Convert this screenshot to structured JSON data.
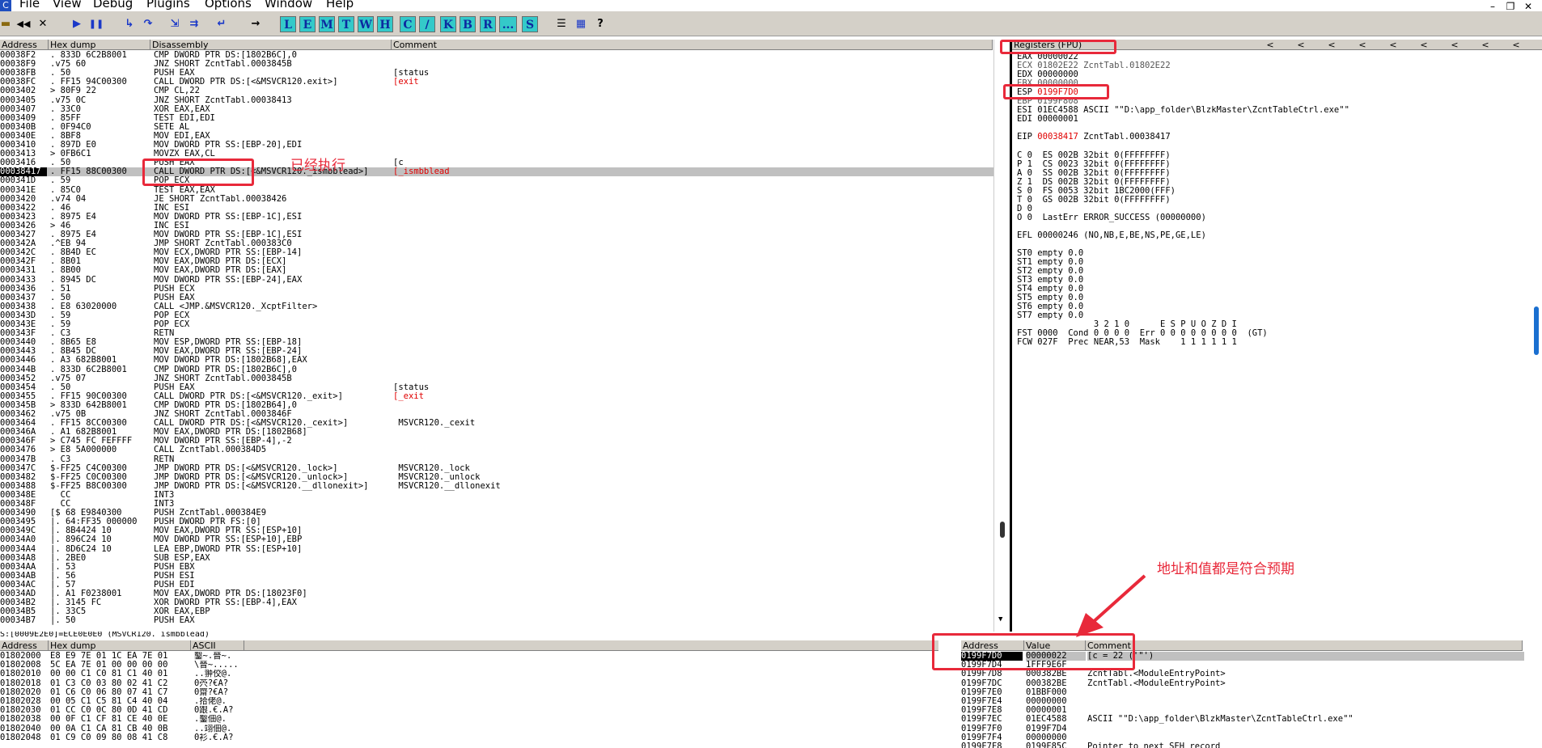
{
  "menubar": {
    "app_icon": "C",
    "items": [
      "File",
      "View",
      "Debug",
      "Plugins",
      "Options",
      "Window",
      "Help"
    ]
  },
  "toolbar": {
    "buttons": [
      {
        "name": "open-icon",
        "glyph": "▬"
      },
      {
        "name": "restart-icon",
        "glyph": "◀◀"
      },
      {
        "name": "close-icon",
        "glyph": "✕"
      },
      {
        "name": "run-icon",
        "glyph": "▶"
      },
      {
        "name": "pause-icon",
        "glyph": "❚❚"
      },
      {
        "name": "step-into-icon",
        "glyph": "↳"
      },
      {
        "name": "step-over-icon",
        "glyph": "↷"
      },
      {
        "name": "trace-into-icon",
        "glyph": "⇲"
      },
      {
        "name": "trace-over-icon",
        "glyph": "⇉"
      },
      {
        "name": "execute-till-return-icon",
        "glyph": "↵"
      },
      {
        "name": "goto-icon",
        "glyph": "→"
      }
    ],
    "letters": [
      "L",
      "E",
      "M",
      "T",
      "W",
      "H",
      "C",
      "/",
      "K",
      "B",
      "R",
      "...",
      "S"
    ],
    "extra": [
      {
        "name": "list-icon",
        "glyph": "☰"
      },
      {
        "name": "grid-icon",
        "glyph": "▦"
      },
      {
        "name": "help-icon",
        "glyph": "?"
      }
    ]
  },
  "disasm": {
    "headers": [
      "Address",
      "Hex dump",
      "Disassembly",
      "Comment"
    ],
    "rows": [
      [
        "00038F2",
        ". 833D 6C2B8001",
        "CMP DWORD PTR DS:[1802B6C],0",
        ""
      ],
      [
        "00038F9",
        ".v75 60",
        "JNZ SHORT ZcntTabl.0003845B",
        ""
      ],
      [
        "00038FB",
        ". 50",
        "PUSH EAX",
        "[status"
      ],
      [
        "00038FC",
        ". FF15 94C00300",
        "CALL DWORD PTR DS:[<&MSVCR120.exit>]",
        "[exit"
      ],
      [
        "0003402",
        "> 80F9 22",
        "CMP CL,22",
        ""
      ],
      [
        "0003405",
        ".v75 0C",
        "JNZ SHORT ZcntTabl.00038413",
        ""
      ],
      [
        "0003407",
        ". 33C0",
        "XOR EAX,EAX",
        ""
      ],
      [
        "0003409",
        ". 85FF",
        "TEST EDI,EDI",
        ""
      ],
      [
        "000340B",
        ". 0F94C0",
        "SETE AL",
        ""
      ],
      [
        "000340E",
        ". 8BF8",
        "MOV EDI,EAX",
        ""
      ],
      [
        "0003410",
        ". 897D E0",
        "MOV DWORD PTR SS:[EBP-20],EDI",
        ""
      ],
      [
        "0003413",
        "> 0FB6C1",
        "MOVZX EAX,CL",
        ""
      ],
      [
        "0003416",
        ". 50",
        "PUSH EAX",
        "[c"
      ],
      [
        "00038417",
        ". FF15 88C00300",
        "CALL DWORD PTR DS:[<&MSVCR120._ismbblead>]",
        "[_ismbblead"
      ],
      [
        "000341D",
        ". 59",
        "POP ECX",
        ""
      ],
      [
        "000341E",
        ". 85C0",
        "TEST EAX,EAX",
        ""
      ],
      [
        "0003420",
        ".v74 04",
        "JE SHORT ZcntTabl.00038426",
        ""
      ],
      [
        "0003422",
        ". 46",
        "INC ESI",
        ""
      ],
      [
        "0003423",
        ". 8975 E4",
        "MOV DWORD PTR SS:[EBP-1C],ESI",
        ""
      ],
      [
        "0003426",
        "> 46",
        "INC ESI",
        ""
      ],
      [
        "0003427",
        ". 8975 E4",
        "MOV DWORD PTR SS:[EBP-1C],ESI",
        ""
      ],
      [
        "000342A",
        ".^EB 94",
        "JMP SHORT ZcntTabl.000383C0",
        ""
      ],
      [
        "000342C",
        ". 8B4D EC",
        "MOV ECX,DWORD PTR SS:[EBP-14]",
        ""
      ],
      [
        "000342F",
        ". 8B01",
        "MOV EAX,DWORD PTR DS:[ECX]",
        ""
      ],
      [
        "0003431",
        ". 8B00",
        "MOV EAX,DWORD PTR DS:[EAX]",
        ""
      ],
      [
        "0003433",
        ". 8945 DC",
        "MOV DWORD PTR SS:[EBP-24],EAX",
        ""
      ],
      [
        "0003436",
        ". 51",
        "PUSH ECX",
        ""
      ],
      [
        "0003437",
        ". 50",
        "PUSH EAX",
        ""
      ],
      [
        "0003438",
        ". E8 63020000",
        "CALL <JMP.&MSVCR120._XcptFilter>",
        ""
      ],
      [
        "000343D",
        ". 59",
        "POP ECX",
        ""
      ],
      [
        "000343E",
        ". 59",
        "POP ECX",
        ""
      ],
      [
        "000343F",
        ". C3",
        "RETN",
        ""
      ],
      [
        "0003440",
        ". 8B65 E8",
        "MOV ESP,DWORD PTR SS:[EBP-18]",
        ""
      ],
      [
        "0003443",
        ". 8B45 DC",
        "MOV EAX,DWORD PTR SS:[EBP-24]",
        ""
      ],
      [
        "0003446",
        ". A3 682B8001",
        "MOV DWORD PTR DS:[1802B68],EAX",
        ""
      ],
      [
        "000344B",
        ". 833D 6C2B8001",
        "CMP DWORD PTR DS:[1802B6C],0",
        ""
      ],
      [
        "0003452",
        ".v75 07",
        "JNZ SHORT ZcntTabl.0003845B",
        ""
      ],
      [
        "0003454",
        ". 50",
        "PUSH EAX",
        "[status"
      ],
      [
        "0003455",
        ". FF15 90C00300",
        "CALL DWORD PTR DS:[<&MSVCR120._exit>]",
        "[_exit"
      ],
      [
        "000345B",
        "> 833D 642B8001",
        "CMP DWORD PTR DS:[1802B64],0",
        ""
      ],
      [
        "0003462",
        ".v75 0B",
        "JNZ SHORT ZcntTabl.0003846F",
        ""
      ],
      [
        "0003464",
        ". FF15 8CC00300",
        "CALL DWORD PTR DS:[<&MSVCR120._cexit>]",
        " MSVCR120._cexit"
      ],
      [
        "000346A",
        ". A1 682B8001",
        "MOV EAX,DWORD PTR DS:[1802B68]",
        ""
      ],
      [
        "000346F",
        "> C745 FC FEFFFF",
        "MOV DWORD PTR SS:[EBP-4],-2",
        ""
      ],
      [
        "0003476",
        "> E8 5A000000",
        "CALL ZcntTabl.000384D5",
        ""
      ],
      [
        "000347B",
        ". C3",
        "RETN",
        ""
      ],
      [
        "000347C",
        "$-FF25 C4C00300",
        "JMP DWORD PTR DS:[<&MSVCR120._lock>]",
        " MSVCR120._lock"
      ],
      [
        "0003482",
        "$-FF25 C0C00300",
        "JMP DWORD PTR DS:[<&MSVCR120._unlock>]",
        " MSVCR120._unlock"
      ],
      [
        "0003488",
        "$-FF25 B8C00300",
        "JMP DWORD PTR DS:[<&MSVCR120.__dllonexit>]",
        " MSVCR120.__dllonexit"
      ],
      [
        "000348E",
        "  CC",
        "INT3",
        ""
      ],
      [
        "000348F",
        "  CC",
        "INT3",
        ""
      ],
      [
        "0003490",
        "[$ 68 E9840300",
        "PUSH ZcntTabl.000384E9",
        ""
      ],
      [
        "0003495",
        "|. 64:FF35 000000",
        "PUSH DWORD PTR FS:[0]",
        ""
      ],
      [
        "000349C",
        "|. 8B4424 10",
        "MOV EAX,DWORD PTR SS:[ESP+10]",
        ""
      ],
      [
        "00034A0",
        "|. 896C24 10",
        "MOV DWORD PTR SS:[ESP+10],EBP",
        ""
      ],
      [
        "00034A4",
        "|. 8D6C24 10",
        "LEA EBP,DWORD PTR SS:[ESP+10]",
        ""
      ],
      [
        "00034A8",
        "|. 2BE0",
        "SUB ESP,EAX",
        ""
      ],
      [
        "00034AA",
        "|. 53",
        "PUSH EBX",
        ""
      ],
      [
        "00034AB",
        "|. 56",
        "PUSH ESI",
        ""
      ],
      [
        "00034AC",
        "|. 57",
        "PUSH EDI",
        ""
      ],
      [
        "00034AD",
        "|. A1 F0238001",
        "MOV EAX,DWORD PTR DS:[18023F0]",
        ""
      ],
      [
        "00034B2",
        "|. 3145 FC",
        "XOR DWORD PTR SS:[EBP-4],EAX",
        ""
      ],
      [
        "00034B5",
        "|. 33C5",
        "XOR EAX,EBP",
        ""
      ],
      [
        "00034B7",
        "|. 50",
        "PUSH EAX",
        ""
      ]
    ],
    "status_line": "S:[0009E2E0]=ECE0E0E0 (MSVCR120._ismbblead)"
  },
  "registers": {
    "title": "Registers (FPU)",
    "arrows": [
      "<",
      "<",
      "<",
      "<",
      "<",
      "<",
      "<",
      "<",
      "<"
    ],
    "lines": [
      {
        "t": "EAX 00000022",
        "c": ""
      },
      {
        "t": "ECX 01802E22 ZcntTabl.01802E22",
        "c": "gray"
      },
      {
        "t": "EDX 00000000",
        "c": ""
      },
      {
        "t": "EBX 00000000",
        "c": "gray"
      },
      {
        "t": "ESP ",
        "v": "0199F7D0",
        "c": ""
      },
      {
        "t": "EBP 0199F808",
        "c": "gray"
      },
      {
        "t": "ESI 01EC4588 ASCII \"\"D:\\app_folder\\BlzkMaster\\ZcntTableCtrl.exe\"\"",
        "c": ""
      },
      {
        "t": "EDI 00000001",
        "c": ""
      },
      {
        "t": "",
        "c": ""
      },
      {
        "t": "EIP ",
        "v": "00038417",
        "tail": " ZcntTabl.00038417",
        "c": ""
      },
      {
        "t": "",
        "c": ""
      },
      {
        "t": "C 0  ES 002B 32bit 0(FFFFFFFF)",
        "c": ""
      },
      {
        "t": "P 1  CS 0023 32bit 0(FFFFFFFF)",
        "c": ""
      },
      {
        "t": "A 0  SS 002B 32bit 0(FFFFFFFF)",
        "c": ""
      },
      {
        "t": "Z 1  DS 002B 32bit 0(FFFFFFFF)",
        "c": ""
      },
      {
        "t": "S 0  FS 0053 32bit 1BC2000(FFF)",
        "c": ""
      },
      {
        "t": "T 0  GS 002B 32bit 0(FFFFFFFF)",
        "c": ""
      },
      {
        "t": "D 0",
        "c": ""
      },
      {
        "t": "O 0  LastErr ERROR_SUCCESS (00000000)",
        "c": ""
      },
      {
        "t": "",
        "c": ""
      },
      {
        "t": "EFL 00000246 (NO,NB,E,BE,NS,PE,GE,LE)",
        "c": ""
      },
      {
        "t": "",
        "c": ""
      },
      {
        "t": "ST0 empty 0.0",
        "c": ""
      },
      {
        "t": "ST1 empty 0.0",
        "c": ""
      },
      {
        "t": "ST2 empty 0.0",
        "c": ""
      },
      {
        "t": "ST3 empty 0.0",
        "c": ""
      },
      {
        "t": "ST4 empty 0.0",
        "c": ""
      },
      {
        "t": "ST5 empty 0.0",
        "c": ""
      },
      {
        "t": "ST6 empty 0.0",
        "c": ""
      },
      {
        "t": "ST7 empty 0.0",
        "c": ""
      },
      {
        "t": "               3 2 1 0      E S P U O Z D I",
        "c": ""
      },
      {
        "t": "FST 0000  Cond 0 0 0 0  Err 0 0 0 0 0 0 0 0  (GT)",
        "c": ""
      },
      {
        "t": "FCW 027F  Prec NEAR,53  Mask    1 1 1 1 1 1",
        "c": ""
      }
    ]
  },
  "dump": {
    "headers": [
      "Address",
      "Hex dump",
      "ASCII"
    ],
    "rows": [
      [
        "01802000",
        "E8 E9 7E 01 1C EA 7E 01",
        "鑿~.晉~."
      ],
      [
        "01802008",
        "5C EA 7E 01 00 00 00 00",
        "\\晉~....."
      ],
      [
        "01802010",
        "00 00 C1 C0 81 C1 40 01",
        "..翀佼@."
      ],
      [
        "01802018",
        "01 C3 C0 03 80 02 41 C2",
        "0茓?€A?"
      ],
      [
        "01802020",
        "01 C6 C0 06 80 07 41 C7",
        "0齋?€A?"
      ],
      [
        "01802028",
        "00 05 C1 C5 81 C4 40 04",
        ".拾佬@."
      ],
      [
        "01802030",
        "01 CC C0 0C 80 0D 41 CD",
        "0跟.€.A?"
      ],
      [
        "01802038",
        "00 0F C1 CF 81 CE 40 0E",
        ".鑿佃@."
      ],
      [
        "01802040",
        "00 0A C1 CA 81 CB 40 0B",
        "..翊佃@."
      ],
      [
        "01802048",
        "01 C9 C0 09 80 08 41 C8",
        "0衫.€.A?"
      ]
    ]
  },
  "stack": {
    "headers": [
      "Address",
      "Value",
      "Comment"
    ],
    "rows": [
      [
        "0199F7D0",
        "00000022",
        "[c = 22 ('\"')"
      ],
      [
        "0199F7D4",
        "1FFF9E6F",
        ""
      ],
      [
        "0199F7D8",
        "000382BE",
        "ZcntTabl.<ModuleEntryPoint>"
      ],
      [
        "0199F7DC",
        "000382BE",
        "ZcntTabl.<ModuleEntryPoint>"
      ],
      [
        "0199F7E0",
        "01BBF000",
        ""
      ],
      [
        "0199F7E4",
        "00000000",
        ""
      ],
      [
        "0199F7E8",
        "00000001",
        ""
      ],
      [
        "0199F7EC",
        "01EC4588",
        "ASCII \"\"D:\\app_folder\\BlzkMaster\\ZcntTableCtrl.exe\"\""
      ],
      [
        "0199F7F0",
        "0199F7D4",
        ""
      ],
      [
        "0199F7F4",
        "00000000",
        ""
      ],
      [
        "0199F7F8",
        "0199F85C",
        "Pointer to next SEH record"
      ]
    ]
  },
  "annotations": {
    "executed": "已经执行",
    "expected": "地址和值都是符合预期"
  },
  "colors": {
    "accent_red": "#e8293a",
    "toolbar_bg": "#d4d0c8",
    "letter_btn": "#34c9c9",
    "value_red": "#e00000"
  }
}
